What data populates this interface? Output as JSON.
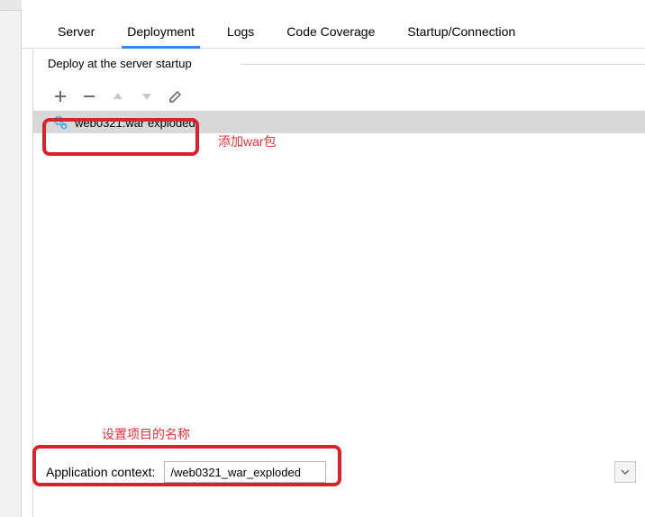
{
  "tabs": {
    "server": "Server",
    "deployment": "Deployment",
    "logs": "Logs",
    "coverage": "Code Coverage",
    "startup": "Startup/Connection"
  },
  "fieldset": {
    "label": "Deploy at the server startup"
  },
  "list": {
    "items": [
      {
        "label": "web0321:war exploded"
      }
    ]
  },
  "annotations": {
    "add_war": "添加war包",
    "set_project_name": "设置项目的名称"
  },
  "context": {
    "label": "Application context:",
    "value": "/web0321_war_exploded"
  },
  "colors": {
    "accent": "#3b82ec",
    "annotation": "#e2333a",
    "highlight_box": "#d8232c"
  }
}
